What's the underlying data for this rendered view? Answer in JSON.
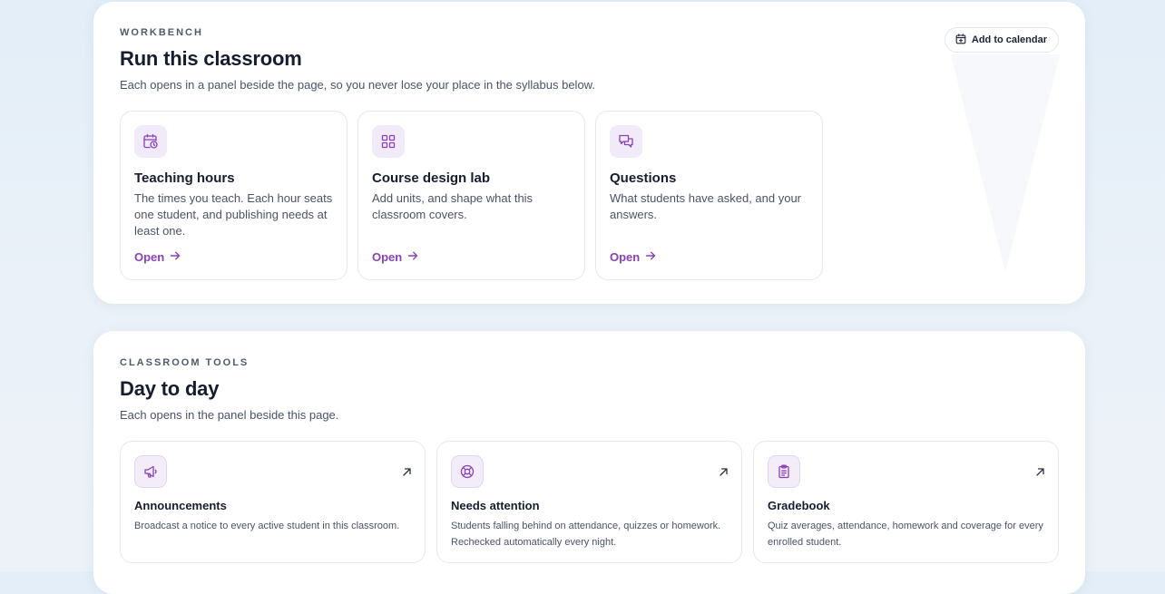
{
  "workbench": {
    "eyebrow": "WORKBENCH",
    "title": "Run this classroom",
    "subtitle": "Each opens in a panel beside the page, so you never lose your place in the syllabus below.",
    "add_to_calendar": {
      "label": "Add to calendar",
      "icon": "calendar-plus-icon"
    },
    "cards": [
      {
        "title": "Teaching hours",
        "description": "The times you teach. Each hour seats one student, and publishing needs at least one.",
        "link": "Open",
        "icon": "calendar-clock-icon"
      },
      {
        "title": "Course design lab",
        "description": "Add units, and shape what this classroom covers.",
        "link": "Open",
        "icon": "grid-icon"
      },
      {
        "title": "Questions",
        "description": "What students have asked, and your answers.",
        "link": "Open",
        "icon": "chat-bubbles-icon"
      }
    ]
  },
  "tools": {
    "eyebrow": "CLASSROOM TOOLS",
    "title": "Day to day",
    "subtitle": "Each opens in the panel beside this page.",
    "items": [
      {
        "title": "Announcements",
        "description": "Broadcast a notice to every active student in this classroom.",
        "icon": "megaphone-icon"
      },
      {
        "title": "Needs attention",
        "description": "Students falling behind on attendance, quizzes or homework. Rechecked automatically every night.",
        "icon": "lifebuoy-icon"
      },
      {
        "title": "Gradebook",
        "description": "Quiz averages, attendance, homework and coverage for every enrolled student.",
        "icon": "clipboard-icon"
      }
    ]
  },
  "colors": {
    "accent": "#8a3fbb",
    "icon_tint": "#f1eaf8",
    "text_primary": "#161d2f",
    "text_secondary": "#4a5366"
  }
}
